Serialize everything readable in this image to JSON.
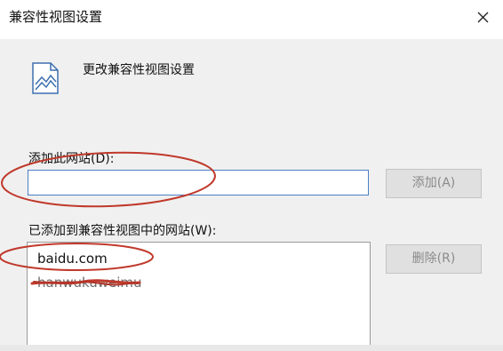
{
  "window": {
    "title": "兼容性视图设置",
    "close_glyph": "✕"
  },
  "header": {
    "icon": "compatibility-view-icon",
    "title": "更改兼容性视图设置"
  },
  "add_site": {
    "label": "添加此网站(D):",
    "value": "",
    "button_label": "添加(A)"
  },
  "site_list": {
    "label": "已添加到兼容性视图中的网站(W):",
    "items": [
      "baidu.com",
      "hanwukuweimu"
    ],
    "remove_button_label": "删除(R)"
  },
  "annotation_color": "#c0392b",
  "colors": {
    "input_border": "#4a7fc4",
    "disabled_button_text": "#8a8a8a",
    "dialog_background": "#f0f0f0"
  }
}
